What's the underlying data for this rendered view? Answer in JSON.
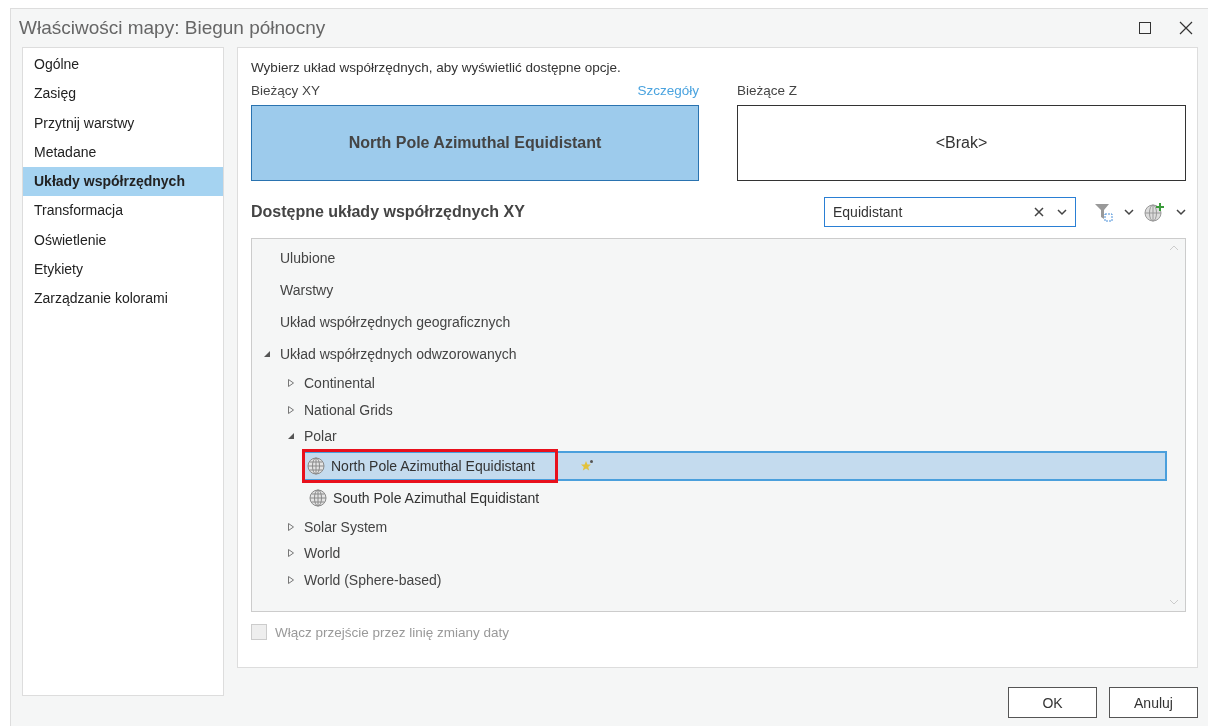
{
  "window": {
    "title": "Właściwości mapy: Biegun północny"
  },
  "sidebar": {
    "items": [
      {
        "label": "Ogólne",
        "selected": false
      },
      {
        "label": "Zasięg",
        "selected": false
      },
      {
        "label": "Przytnij warstwy",
        "selected": false
      },
      {
        "label": "Metadane",
        "selected": false
      },
      {
        "label": "Układy współrzędnych",
        "selected": true
      },
      {
        "label": "Transformacja",
        "selected": false
      },
      {
        "label": "Oświetlenie",
        "selected": false
      },
      {
        "label": "Etykiety",
        "selected": false
      },
      {
        "label": "Zarządzanie kolorami",
        "selected": false
      }
    ]
  },
  "instruction": "Wybierz układ współrzędnych, aby wyświetlić dostępne opcje.",
  "current_xy": {
    "label": "Bieżący XY",
    "link": "Szczegóły",
    "value": "North Pole Azimuthal Equidistant"
  },
  "current_z": {
    "label": "Bieżące Z",
    "value": "<Brak>"
  },
  "available": {
    "heading": "Dostępne układy współrzędnych XY",
    "search": {
      "value": "Equidistant"
    }
  },
  "tree": [
    {
      "label": "Ulubione",
      "kind": "group"
    },
    {
      "label": "Warstwy",
      "kind": "group"
    },
    {
      "label": "Układ współrzędnych geograficznych",
      "kind": "group"
    },
    {
      "label": "Układ współrzędnych odwzorowanych",
      "kind": "folder",
      "expanded": true,
      "children": [
        {
          "label": "Continental",
          "kind": "folder",
          "expanded": false
        },
        {
          "label": "National Grids",
          "kind": "folder",
          "expanded": false
        },
        {
          "label": "Polar",
          "kind": "folder",
          "expanded": true,
          "children": [
            {
              "label": "North Pole Azimuthal Equidistant",
              "kind": "system",
              "selected": true,
              "highlighted": true
            },
            {
              "label": "South Pole Azimuthal Equidistant",
              "kind": "system",
              "selected": false,
              "highlighted": false
            }
          ]
        },
        {
          "label": "Solar System",
          "kind": "folder",
          "expanded": false
        },
        {
          "label": "World",
          "kind": "folder",
          "expanded": false
        },
        {
          "label": "World (Sphere-based)",
          "kind": "folder",
          "expanded": false
        }
      ]
    }
  ],
  "dateline": {
    "label": "Włącz przejście przez linię zmiany daty",
    "checked": false,
    "disabled": true
  },
  "buttons": [
    "OK",
    "Anuluj"
  ]
}
